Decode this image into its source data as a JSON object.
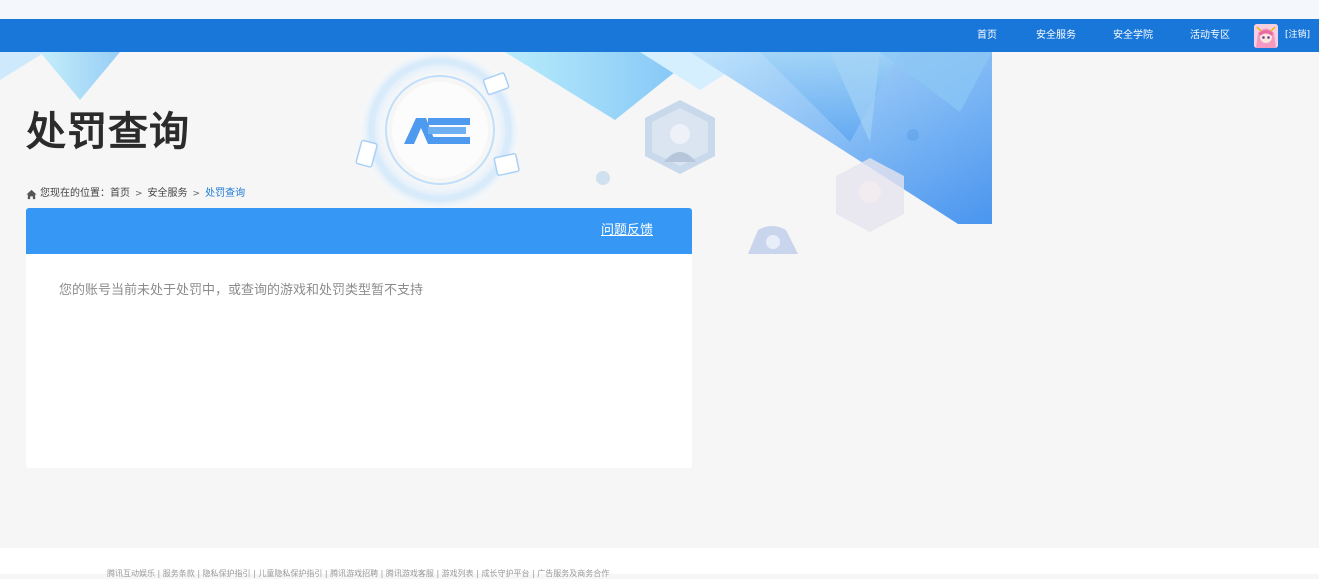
{
  "nav": {
    "items": [
      {
        "label": "首页"
      },
      {
        "label": "安全服务"
      },
      {
        "label": "安全学院"
      },
      {
        "label": "活动专区"
      }
    ],
    "logout": "[注销]"
  },
  "banner": {
    "logo_text": "ACE"
  },
  "page": {
    "title": "处罚查询"
  },
  "breadcrumb": {
    "prefix": "您现在的位置：",
    "items": [
      "首页",
      "安全服务"
    ],
    "current": "处罚查询",
    "separator": ">"
  },
  "panel": {
    "feedback_label": "问题反馈",
    "message": "您的账号当前未处于处罚中，或查询的游戏和处罚类型暂不支持"
  },
  "footer": {
    "links_text": "腾讯互动娱乐 | 服务条款 | 隐私保护指引 | 儿童隐私保护指引 | 腾讯游戏招聘 | 腾讯游戏客服 | 游戏列表 | 成长守护平台 | 广告服务及商务合作"
  },
  "colors": {
    "nav_bg": "#1877d9",
    "panel_header_bg": "#3697f5",
    "breadcrumb_current": "#1d7ad6"
  }
}
